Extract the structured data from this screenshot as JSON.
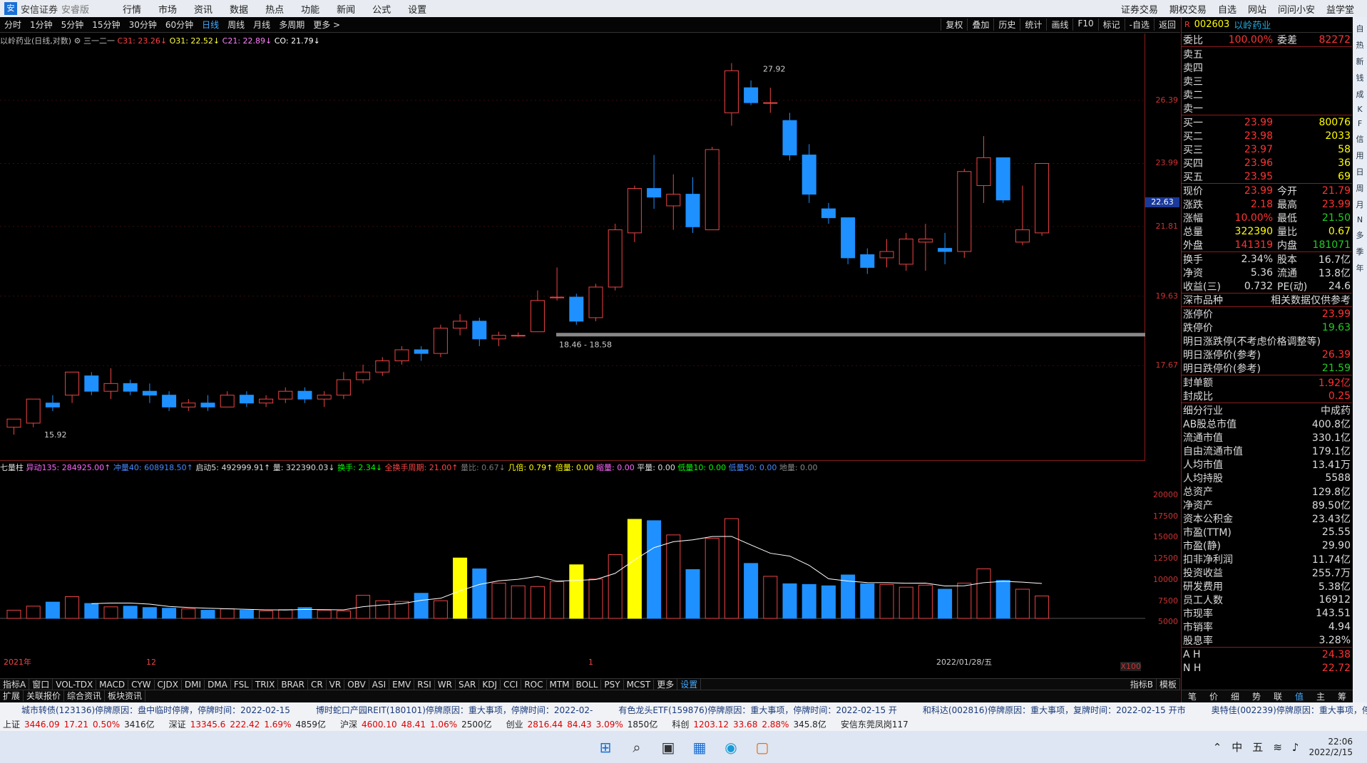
{
  "app": {
    "logo_text": "安信证券",
    "sub": "安睿版"
  },
  "menu": [
    "行情",
    "市场",
    "资讯",
    "数据",
    "热点",
    "功能",
    "新闻",
    "公式",
    "设置"
  ],
  "menu_right": [
    "证券交易",
    "期权交易",
    "自选",
    "网站",
    "问问小安",
    "益学堂"
  ],
  "periods": [
    "分时",
    "1分钟",
    "5分钟",
    "15分钟",
    "30分钟",
    "60分钟",
    "日线",
    "周线",
    "月线",
    "多周期",
    "更多 >"
  ],
  "period_selected": "日线",
  "tools": [
    "复权",
    "叠加",
    "历史",
    "统计",
    "画线",
    "F10",
    "标记",
    "-自选",
    "返回"
  ],
  "legend": {
    "name": "以岭药业(日线,对数)",
    "indicator": "三一二一",
    "c31": "C31: 23.26↓",
    "o31": "O31: 22.52↓",
    "c21": "C21: 22.89↓",
    "co": "CO: 21.79↓"
  },
  "chart_data": {
    "type": "candlestick",
    "dates_end": "2022/01/28/五",
    "ylabels": [
      "26.39",
      "23.99",
      "21.81",
      "19.63",
      "17.67"
    ],
    "current": "22.63",
    "high_label": "27.92",
    "low_label": "15.92",
    "range_label": "18.46 - 18.58",
    "candles": [
      [
        16.1,
        16.3,
        15.92,
        16.2
      ],
      [
        16.2,
        16.8,
        16.1,
        16.7
      ],
      [
        16.7,
        16.6,
        16.5,
        16.9
      ],
      [
        16.9,
        17.5,
        16.7,
        17.4
      ],
      [
        17.4,
        17.0,
        16.9,
        17.5
      ],
      [
        17.0,
        17.2,
        16.8,
        17.6
      ],
      [
        17.2,
        17.0,
        16.9,
        17.3
      ],
      [
        17.0,
        16.9,
        16.7,
        17.2
      ],
      [
        16.9,
        16.6,
        16.5,
        17.0
      ],
      [
        16.6,
        16.7,
        16.5,
        16.8
      ],
      [
        16.7,
        16.6,
        16.5,
        16.9
      ],
      [
        16.6,
        16.9,
        16.6,
        17.0
      ],
      [
        16.9,
        16.7,
        16.6,
        17.0
      ],
      [
        16.7,
        16.8,
        16.6,
        16.9
      ],
      [
        16.8,
        17.0,
        16.7,
        17.1
      ],
      [
        17.0,
        16.8,
        16.7,
        17.1
      ],
      [
        16.8,
        16.9,
        16.6,
        17.0
      ],
      [
        16.9,
        17.3,
        16.8,
        17.5
      ],
      [
        17.3,
        17.5,
        17.2,
        17.7
      ],
      [
        17.5,
        17.8,
        17.4,
        17.9
      ],
      [
        17.8,
        18.1,
        17.7,
        18.2
      ],
      [
        18.1,
        18.0,
        17.8,
        18.2
      ],
      [
        18.0,
        18.7,
        17.9,
        18.8
      ],
      [
        18.7,
        18.9,
        18.5,
        19.1
      ],
      [
        18.9,
        18.4,
        18.2,
        19.0
      ],
      [
        18.4,
        18.5,
        18.2,
        18.6
      ],
      [
        18.5,
        18.5,
        18.46,
        18.58
      ],
      [
        18.6,
        19.5,
        18.6,
        19.8
      ],
      [
        19.6,
        19.6,
        19.5,
        20.5
      ],
      [
        19.6,
        18.9,
        18.8,
        19.7
      ],
      [
        19.0,
        19.9,
        18.9,
        20.0
      ],
      [
        19.9,
        21.7,
        19.8,
        21.9
      ],
      [
        21.6,
        23.1,
        21.3,
        23.2
      ],
      [
        23.1,
        22.8,
        22.4,
        24.3
      ],
      [
        22.5,
        22.9,
        21.7,
        23.6
      ],
      [
        22.9,
        21.8,
        21.6,
        23.5
      ],
      [
        21.7,
        24.5,
        21.7,
        24.6
      ],
      [
        25.9,
        27.6,
        25.4,
        27.92
      ],
      [
        26.9,
        26.3,
        26.2,
        27.2
      ],
      [
        26.3,
        26.3,
        25.9,
        26.9
      ],
      [
        25.6,
        24.3,
        24.1,
        25.9
      ],
      [
        24.3,
        22.9,
        22.6,
        24.7
      ],
      [
        22.4,
        22.1,
        21.9,
        22.6
      ],
      [
        22.1,
        20.8,
        20.6,
        22.0
      ],
      [
        20.9,
        20.5,
        20.3,
        21.1
      ],
      [
        20.8,
        21.0,
        20.5,
        21.4
      ],
      [
        20.6,
        21.4,
        20.4,
        21.6
      ],
      [
        21.3,
        21.4,
        20.4,
        21.9
      ],
      [
        21.1,
        21.0,
        20.6,
        21.6
      ],
      [
        21.0,
        23.7,
        20.8,
        23.8
      ],
      [
        23.2,
        24.2,
        22.6,
        25.0
      ],
      [
        24.2,
        22.7,
        22.6,
        24.2
      ],
      [
        21.3,
        21.7,
        21.2,
        23.2
      ],
      [
        21.6,
        23.99,
        21.5,
        23.99
      ]
    ],
    "vol_labels": [
      "20000",
      "17500",
      "15000",
      "12500",
      "10000",
      "7500",
      "5000"
    ],
    "vol_unit": "X100",
    "vol_max": 21000
  },
  "volhdr": {
    "t": "七量柱",
    "a": "异动135: 284925.00↑",
    "b": "冲量40: 608918.50↑",
    "c": "启动5: 492999.91↑",
    "d": "量: 322390.03↓",
    "e": "换手: 2.34↓",
    "f": "全换手周期: 21.00↑",
    "g": "量比: 0.67↓",
    "h": "几倍: 0.79↑",
    "i": "倍量: 0.00",
    "j": "缩量: 0.00",
    "k": "平量: 0.00",
    "l": "低量10: 0.00",
    "m": "低量50: 0.00",
    "n": "地量: 0.00"
  },
  "date_left": "2021年",
  "date_mid": "12",
  "date_1": "1",
  "indicators": [
    "指标A",
    "窗口",
    "VOL-TDX",
    "MACD",
    "CYW",
    "CJDX",
    "DMI",
    "DMA",
    "FSL",
    "TRIX",
    "BRAR",
    "CR",
    "VR",
    "OBV",
    "ASI",
    "EMV",
    "RSI",
    "WR",
    "SAR",
    "KDJ",
    "CCI",
    "ROC",
    "MTM",
    "BOLL",
    "PSY",
    "MCST",
    "更多",
    "设置"
  ],
  "ind_right": [
    "指标B",
    "模板"
  ],
  "ind2": [
    "扩展",
    "关联报价",
    "综合资讯",
    "板块资讯"
  ],
  "ticker": [
    "城市转债(123136)停牌原因：盘中临时停牌，停牌时间：2022-02-15",
    "博时蛇口产园REIT(180101)停牌原因：重大事项，停牌时间：2022-02-",
    "有色龙头ETF(159876)停牌原因：重大事项，停牌时间：2022-02-15 开",
    "和科达(002816)停牌原因：重大事项，复牌时间：2022-02-15 开市",
    "奥特佳(002239)停牌原因：重大事项，停牌"
  ],
  "indexes": [
    {
      "n": "上证",
      "v": "3446.09",
      "c": "17.21",
      "p": "0.50%",
      "a": "3416亿"
    },
    {
      "n": "深证",
      "v": "13345.6",
      "c": "222.42",
      "p": "1.69%",
      "a": "4859亿"
    },
    {
      "n": "沪深",
      "v": "4600.10",
      "c": "48.41",
      "p": "1.06%",
      "a": "2500亿"
    },
    {
      "n": "创业",
      "v": "2816.44",
      "c": "84.43",
      "p": "3.09%",
      "a": "1850亿"
    },
    {
      "n": "科创",
      "v": "1203.12",
      "c": "33.68",
      "p": "2.88%",
      "a": "345.8亿"
    }
  ],
  "idx_tail": "安信东莞凤岗117",
  "taskbar": {
    "time": "22:06",
    "date": "2022/2/15",
    "ime": "中",
    "ime2": "五"
  },
  "quote": {
    "code": "002603",
    "name": "以岭药业",
    "r": "R",
    "rsub": "500",
    "weibi_l": "委比",
    "weibi": "100.00%",
    "weicha_l": "委差",
    "weicha": "82272",
    "sell": [
      "卖五",
      "卖四",
      "卖三",
      "卖二",
      "卖一"
    ],
    "buy": [
      [
        "买一",
        "23.99",
        "80076"
      ],
      [
        "买二",
        "23.98",
        "2033"
      ],
      [
        "买三",
        "23.97",
        "58"
      ],
      [
        "买四",
        "23.96",
        "36"
      ],
      [
        "买五",
        "23.95",
        "69"
      ]
    ],
    "rows": [
      [
        "现价",
        "23.99",
        "今开",
        "21.79"
      ],
      [
        "涨跌",
        "2.18",
        "最高",
        "23.99"
      ],
      [
        "涨幅",
        "10.00%",
        "最低",
        "21.50"
      ],
      [
        "总量",
        "322390",
        "量比",
        "0.67"
      ],
      [
        "外盘",
        "141319",
        "内盘",
        "181071"
      ]
    ],
    "rows2": [
      [
        "换手",
        "2.34%",
        "股本",
        "16.7亿"
      ],
      [
        "净资",
        "5.36",
        "流通",
        "13.8亿"
      ],
      [
        "收益(三)",
        "0.732",
        "PE(动)",
        "24.6"
      ]
    ],
    "market": "深市品种",
    "market_note": "相关数据仅供参考",
    "limit": [
      [
        "涨停价",
        "23.99"
      ],
      [
        "跌停价",
        "19.63"
      ]
    ],
    "next_note": "明日涨跌停(不考虑价格调整等)",
    "next": [
      [
        "明日涨停价(参考)",
        "26.39"
      ],
      [
        "明日跌停价(参考)",
        "21.59"
      ]
    ],
    "seal": [
      [
        "封单额",
        "1.92亿"
      ],
      [
        "封成比",
        "0.25"
      ]
    ],
    "fund": [
      [
        "细分行业",
        "中成药"
      ],
      [
        "AB股总市值",
        "400.8亿"
      ],
      [
        "流通市值",
        "330.1亿"
      ],
      [
        "自由流通市值",
        "179.1亿"
      ],
      [
        "人均市值",
        "13.41万"
      ],
      [
        "人均持股",
        "5588"
      ],
      [
        "总资产",
        "129.8亿"
      ],
      [
        "净资产",
        "89.50亿"
      ],
      [
        "资本公积金",
        "23.43亿"
      ],
      [
        "市盈(TTM)",
        "25.55"
      ],
      [
        "市盈(静)",
        "29.90"
      ],
      [
        "扣非净利润",
        "11.74亿"
      ],
      [
        "投资收益",
        "255.7万"
      ],
      [
        "研发费用",
        "5.38亿"
      ],
      [
        "员工人数",
        "16912"
      ],
      [
        "市现率",
        "143.51"
      ],
      [
        "市销率",
        "4.94"
      ],
      [
        "股息率",
        "3.28%"
      ]
    ],
    "ah": [
      [
        "A H",
        "24.38"
      ],
      [
        "N H",
        "22.72"
      ]
    ],
    "tabs": [
      "笔",
      "价",
      "细",
      "势",
      "联",
      "值",
      "主",
      "筹"
    ]
  },
  "side": [
    "自",
    "热",
    "新",
    "钱",
    "成",
    "K",
    "F",
    "信",
    "用",
    "日",
    "周",
    "月",
    "N",
    "多",
    "季",
    "年"
  ]
}
